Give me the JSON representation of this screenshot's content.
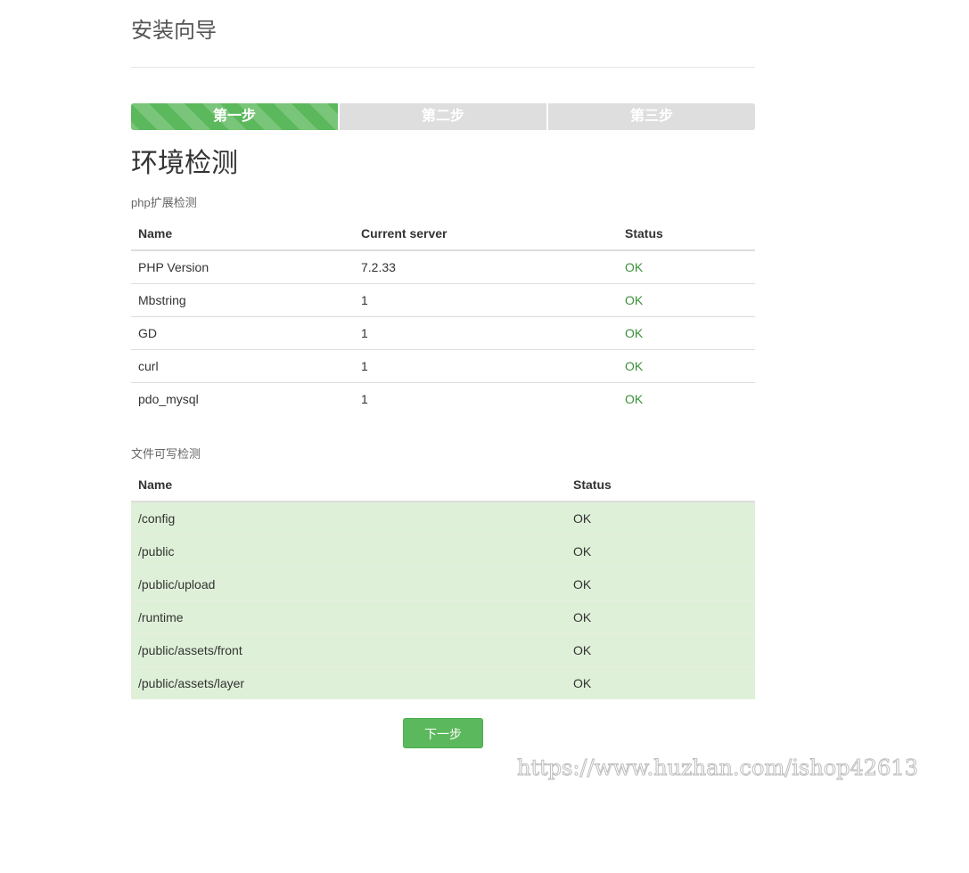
{
  "header": {
    "title": "安装向导"
  },
  "steps": [
    {
      "label": "第一步",
      "active": true
    },
    {
      "label": "第二步",
      "active": false
    },
    {
      "label": "第三步",
      "active": false
    }
  ],
  "section": {
    "title": "环境检测"
  },
  "php_ext": {
    "heading": "php扩展检测",
    "columns": [
      "Name",
      "Current server",
      "Status"
    ],
    "rows": [
      {
        "name": "PHP Version",
        "current": "7.2.33",
        "status": "OK"
      },
      {
        "name": "Mbstring",
        "current": "1",
        "status": "OK"
      },
      {
        "name": "GD",
        "current": "1",
        "status": "OK"
      },
      {
        "name": "curl",
        "current": "1",
        "status": "OK"
      },
      {
        "name": "pdo_mysql",
        "current": "1",
        "status": "OK"
      }
    ]
  },
  "writable": {
    "heading": "文件可写检测",
    "columns": [
      "Name",
      "Status"
    ],
    "rows": [
      {
        "name": "/config",
        "status": "OK"
      },
      {
        "name": "/public",
        "status": "OK"
      },
      {
        "name": "/public/upload",
        "status": "OK"
      },
      {
        "name": "/runtime",
        "status": "OK"
      },
      {
        "name": "/public/assets/front",
        "status": "OK"
      },
      {
        "name": "/public/assets/layer",
        "status": "OK"
      }
    ]
  },
  "actions": {
    "next_label": "下一步"
  },
  "watermark": "https://www.huzhan.com/ishop42613",
  "colors": {
    "accent": "#5cb85c",
    "ok_text": "#3c8f3c",
    "success_row": "#dff0d8",
    "step_inactive": "#dedede"
  }
}
